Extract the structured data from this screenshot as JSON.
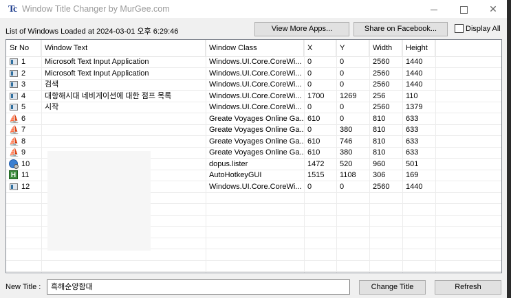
{
  "window": {
    "app_icon": "Tc",
    "title": "Window Title Changer by MurGee.com"
  },
  "toolbar": {
    "loaded_text": "List of Windows Loaded at 2024-03-01 오후 6:29:46",
    "view_more_label": "View More Apps...",
    "share_label": "Share on Facebook...",
    "display_all_label": "Display All",
    "display_all_checked": false
  },
  "table": {
    "columns": [
      "Sr No",
      "Window Text",
      "Window Class",
      "X",
      "Y",
      "Width",
      "Height"
    ],
    "rows": [
      {
        "icon": "window-icon",
        "sr": "1",
        "text": "Microsoft Text Input Application",
        "cls": "Windows.UI.Core.CoreWi...",
        "x": "0",
        "y": "0",
        "w": "2560",
        "h": "1440"
      },
      {
        "icon": "window-icon",
        "sr": "2",
        "text": "Microsoft Text Input Application",
        "cls": "Windows.UI.Core.CoreWi...",
        "x": "0",
        "y": "0",
        "w": "2560",
        "h": "1440"
      },
      {
        "icon": "window-icon",
        "sr": "3",
        "text": "검색",
        "cls": "Windows.UI.Core.CoreWi...",
        "x": "0",
        "y": "0",
        "w": "2560",
        "h": "1440"
      },
      {
        "icon": "window-icon",
        "sr": "4",
        "text": "대항해시대 네비게이션에 대한 점프 목록",
        "cls": "Windows.UI.Core.CoreWi...",
        "x": "1700",
        "y": "1269",
        "w": "256",
        "h": "110"
      },
      {
        "icon": "window-icon",
        "sr": "5",
        "text": "시작",
        "cls": "Windows.UI.Core.CoreWi...",
        "x": "0",
        "y": "0",
        "w": "2560",
        "h": "1379"
      },
      {
        "icon": "ship-icon",
        "sr": "6",
        "text": "",
        "cls": "Greate Voyages Online Ga...",
        "x": "610",
        "y": "0",
        "w": "810",
        "h": "633"
      },
      {
        "icon": "ship-icon",
        "sr": "7",
        "text": "",
        "cls": "Greate Voyages Online Ga...",
        "x": "0",
        "y": "380",
        "w": "810",
        "h": "633"
      },
      {
        "icon": "ship-icon",
        "sr": "8",
        "text": "",
        "cls": "Greate Voyages Online Ga...",
        "x": "610",
        "y": "746",
        "w": "810",
        "h": "633"
      },
      {
        "icon": "ship-icon",
        "sr": "9",
        "text": "",
        "cls": "Greate Voyages Online Ga...",
        "x": "610",
        "y": "380",
        "w": "810",
        "h": "633"
      },
      {
        "icon": "globe-icon",
        "sr": "10",
        "text": "",
        "cls": "dopus.lister",
        "x": "1472",
        "y": "520",
        "w": "960",
        "h": "501"
      },
      {
        "icon": "autohotkey-icon",
        "sr": "11",
        "text": "",
        "cls": "AutoHotkeyGUI",
        "x": "1515",
        "y": "1108",
        "w": "306",
        "h": "169"
      },
      {
        "icon": "window-icon",
        "sr": "12",
        "text": "",
        "cls": "Windows.UI.Core.CoreWi...",
        "x": "0",
        "y": "0",
        "w": "2560",
        "h": "1440"
      }
    ]
  },
  "footer": {
    "new_title_label": "New Title :",
    "new_title_value": "흑해순양함대",
    "change_title_label": "Change Title",
    "refresh_label": "Refresh"
  }
}
